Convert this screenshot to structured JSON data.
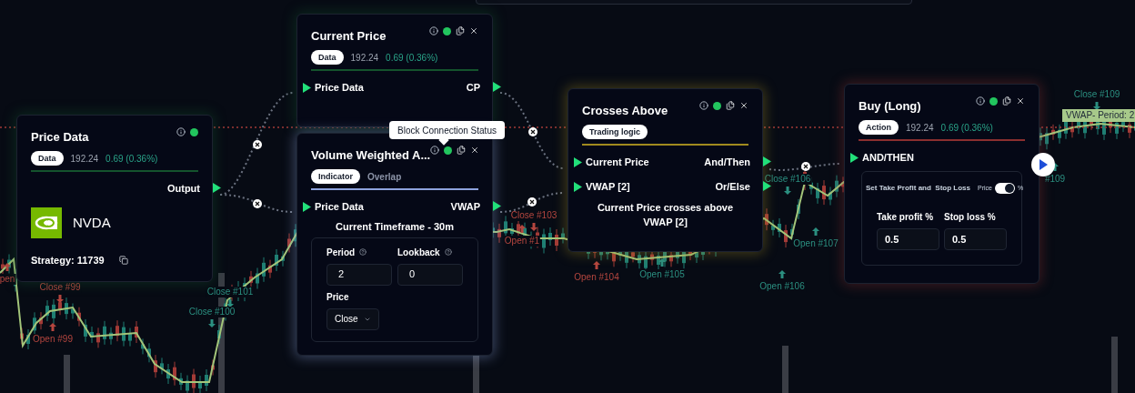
{
  "chart": {
    "labels": [
      {
        "text": "Close #99",
        "kind": "close",
        "color": "#b5463f"
      },
      {
        "text": "Open #99",
        "kind": "open",
        "color": "#b5463f"
      },
      {
        "text": "Close #101",
        "kind": "close",
        "color": "#2b8f80"
      },
      {
        "text": "Close #100",
        "kind": "close",
        "color": "#2b8f80"
      },
      {
        "text": "Close #103",
        "kind": "close",
        "color": "#b5463f"
      },
      {
        "text": "Open #1",
        "kind": "open",
        "color": "#b5463f"
      },
      {
        "text": "Open #104",
        "kind": "open",
        "color": "#b5463f"
      },
      {
        "text": "Open #105",
        "kind": "open",
        "color": "#2b8f80"
      },
      {
        "text": "Open #106",
        "kind": "open",
        "color": "#2b8f80"
      },
      {
        "text": "Open #107",
        "kind": "open",
        "color": "#2b8f80"
      },
      {
        "text": "Close #106",
        "kind": "close",
        "color": "#2b8f80"
      },
      {
        "text": "Close #109",
        "kind": "close",
        "color": "#2b8f80"
      },
      {
        "text": "#109",
        "kind": "open",
        "color": "#2b8f80"
      },
      {
        "text": "pen",
        "kind": "open",
        "color": "#b5463f"
      }
    ],
    "series_tag": "VWAP- Period: 2"
  },
  "tooltip": {
    "text": "Block Connection Status"
  },
  "nodes": [
    {
      "kind": "source",
      "title": "Price Data",
      "color": "#14532d",
      "status_on": true,
      "tools": false,
      "tags": [
        {
          "label": "Data",
          "kind": "pill"
        }
      ],
      "price": "192.24",
      "change": "0.69 (0.36%)",
      "ports_out": [
        "Output"
      ],
      "symbol": "NVDA",
      "strategy": "Strategy: 11739"
    },
    {
      "kind": "plain",
      "title": "Current Price",
      "color": "#14532d",
      "status_on": true,
      "tools": true,
      "tags": [
        {
          "label": "Data",
          "kind": "pill"
        }
      ],
      "price": "192.24",
      "change": "0.69 (0.36%)",
      "ports_in": [
        "Price Data"
      ],
      "ports_out": [
        "CP"
      ]
    },
    {
      "kind": "indicator",
      "title": "Volume Weighted A...",
      "color": "#8da2dd",
      "status_on": true,
      "tools": true,
      "tags": [
        {
          "label": "Indicator",
          "kind": "pill"
        },
        {
          "label": "Overlap",
          "kind": "text"
        }
      ],
      "ports_in": [
        "Price Data"
      ],
      "ports_out": [
        "VWAP"
      ],
      "timeframe": "Current Timeframe - 30m",
      "params": [
        {
          "label": "Period",
          "value": "2"
        },
        {
          "label": "Lookback",
          "value": "0"
        }
      ],
      "select": {
        "label": "Price",
        "value": "Close"
      }
    },
    {
      "kind": "logic",
      "title": "Crosses Above",
      "color": "#a18a1e",
      "status_on": true,
      "tools": true,
      "tags": [
        {
          "label": "Trading logic",
          "kind": "pill"
        }
      ],
      "ports_in": [
        "Current Price",
        "VWAP [2]"
      ],
      "ports_out": [
        "And/Then",
        "Or/Else"
      ],
      "description": "Current Price crosses above VWAP [2]"
    },
    {
      "kind": "action",
      "title": "Buy (Long)",
      "color": "#8b2f2f",
      "status_on": true,
      "tools": true,
      "tags": [
        {
          "label": "Action",
          "kind": "pill"
        }
      ],
      "price": "192.24",
      "change": "0.69 (0.36%)",
      "ports_in": [
        "AND/THEN"
      ],
      "settings": {
        "title": "Set Take Profit and  Stop Loss",
        "toggle": {
          "left": "Price",
          "right": "%",
          "on": true
        },
        "fields": [
          {
            "label": "Take profit %",
            "value": "0.5"
          },
          {
            "label": "Stop loss %",
            "value": "0.5"
          }
        ]
      }
    }
  ]
}
